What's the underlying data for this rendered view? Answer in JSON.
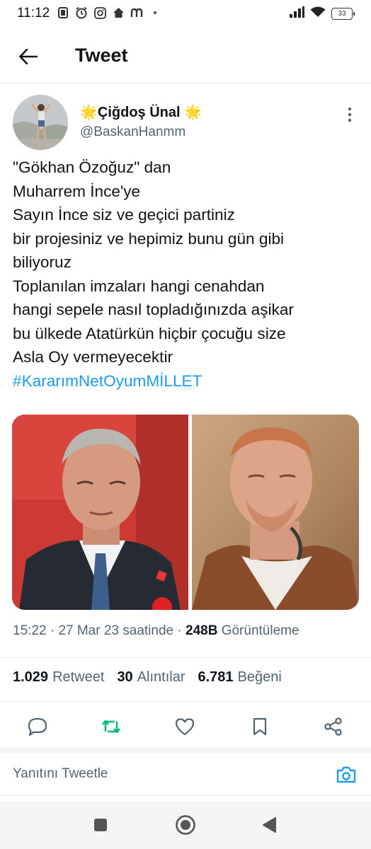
{
  "status_bar": {
    "time": "11:12",
    "battery": "33",
    "icons": [
      "notification-icon",
      "alarm-icon",
      "instagram-icon",
      "home-icon",
      "m-app-icon",
      "dot-icon",
      "signal-icon",
      "wifi-icon",
      "battery-icon"
    ]
  },
  "header": {
    "title": "Tweet"
  },
  "author": {
    "name": "🌟Çiğdoş Ünal 🌟",
    "handle": "@BaskanHanmm"
  },
  "tweet": {
    "lines": [
      "\"Gökhan Özoğuz\" dan",
      "Muharrem İnce'ye",
      "Sayın İnce siz ve geçici partiniz",
      "bir projesiniz ve hepimiz bunu gün gibi",
      "biliyoruz",
      "Toplanılan imzaları hangi cenahdan",
      "hangi sepele nasıl topladığınızda aşikar",
      "bu ülkede Atatürkün hiçbir çocuğu size",
      "Asla Oy vermeyecektir"
    ],
    "hashtag": "#KararımNetOyumMİLLET"
  },
  "meta": {
    "time": "15:22",
    "sep1": " · ",
    "date": "27 Mar 23 saatinde",
    "sep2": " · ",
    "views_count": "248B",
    "views_label": " Görüntüleme"
  },
  "stats": {
    "retweets": {
      "count": "1.029",
      "label": "Retweet"
    },
    "quotes": {
      "count": "30",
      "label": "Alıntılar"
    },
    "likes": {
      "count": "6.781",
      "label": "Beğeni"
    }
  },
  "reply": {
    "placeholder": "Yanıtını Tweetle"
  },
  "colors": {
    "accent": "#1d9bf0",
    "retweet_green": "#00ba7c",
    "text": "#0f1419",
    "secondary": "#536471"
  }
}
